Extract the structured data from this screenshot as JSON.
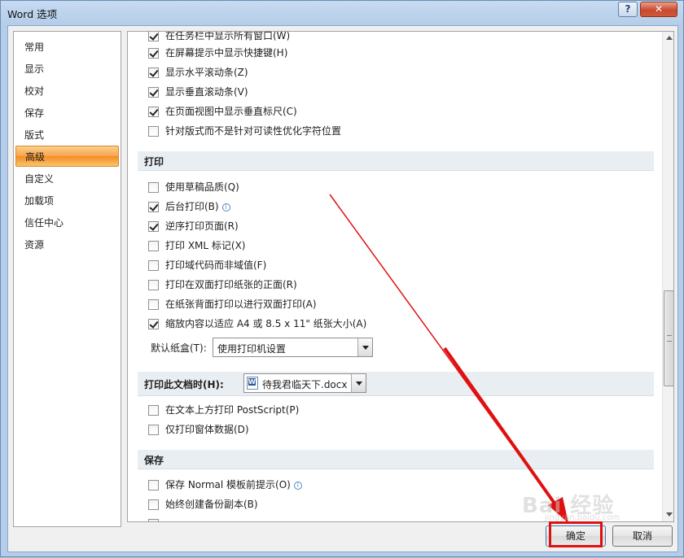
{
  "window": {
    "title": "Word 选项",
    "help_label": "?",
    "close_label": "✕"
  },
  "nav": {
    "items": [
      {
        "label": "常用"
      },
      {
        "label": "显示"
      },
      {
        "label": "校对"
      },
      {
        "label": "保存"
      },
      {
        "label": "版式"
      },
      {
        "label": "高级",
        "selected": true
      },
      {
        "label": "自定义"
      },
      {
        "label": "加载项"
      },
      {
        "label": "信任中心"
      },
      {
        "label": "资源"
      }
    ]
  },
  "display_options": [
    {
      "label": "在任务栏中显示所有窗口(W)",
      "checked": true
    },
    {
      "label": "在屏幕提示中显示快捷键(H)",
      "checked": true
    },
    {
      "label": "显示水平滚动条(Z)",
      "checked": true
    },
    {
      "label": "显示垂直滚动条(V)",
      "checked": true
    },
    {
      "label": "在页面视图中显示垂直标尺(C)",
      "checked": true
    },
    {
      "label": "针对版式而不是针对可读性优化字符位置",
      "checked": false
    }
  ],
  "print_section": {
    "title": "打印",
    "options": [
      {
        "label": "使用草稿品质(Q)",
        "checked": false
      },
      {
        "label": "后台打印(B)",
        "checked": true,
        "info": true
      },
      {
        "label": "逆序打印页面(R)",
        "checked": true
      },
      {
        "label": "打印 XML 标记(X)",
        "checked": false
      },
      {
        "label": "打印域代码而非域值(F)",
        "checked": false
      },
      {
        "label": "打印在双面打印纸张的正面(R)",
        "checked": false
      },
      {
        "label": "在纸张背面打印以进行双面打印(A)",
        "checked": false
      },
      {
        "label": "缩放内容以适应 A4 或 8.5 x 11\" 纸张大小(A)",
        "checked": true
      }
    ],
    "tray_label": "默认纸盒(T):",
    "tray_value": "使用打印机设置"
  },
  "print_doc_section": {
    "title": "打印此文档时(H):",
    "document": "待我君临天下.docx",
    "options": [
      {
        "label": "在文本上方打印 PostScript(P)",
        "checked": false
      },
      {
        "label": "仅打印窗体数据(D)",
        "checked": false
      }
    ]
  },
  "save_section": {
    "title": "保存",
    "options": [
      {
        "label": "保存 Normal 模板前提示(O)",
        "checked": false,
        "info": true
      },
      {
        "label": "始终创建备份副本(B)",
        "checked": false
      }
    ]
  },
  "buttons": {
    "ok": "确定",
    "cancel": "取消"
  },
  "watermark": {
    "main": "Bai 经验",
    "sub": "jingyan.baidu.com"
  },
  "annotation_color": "#e01010"
}
